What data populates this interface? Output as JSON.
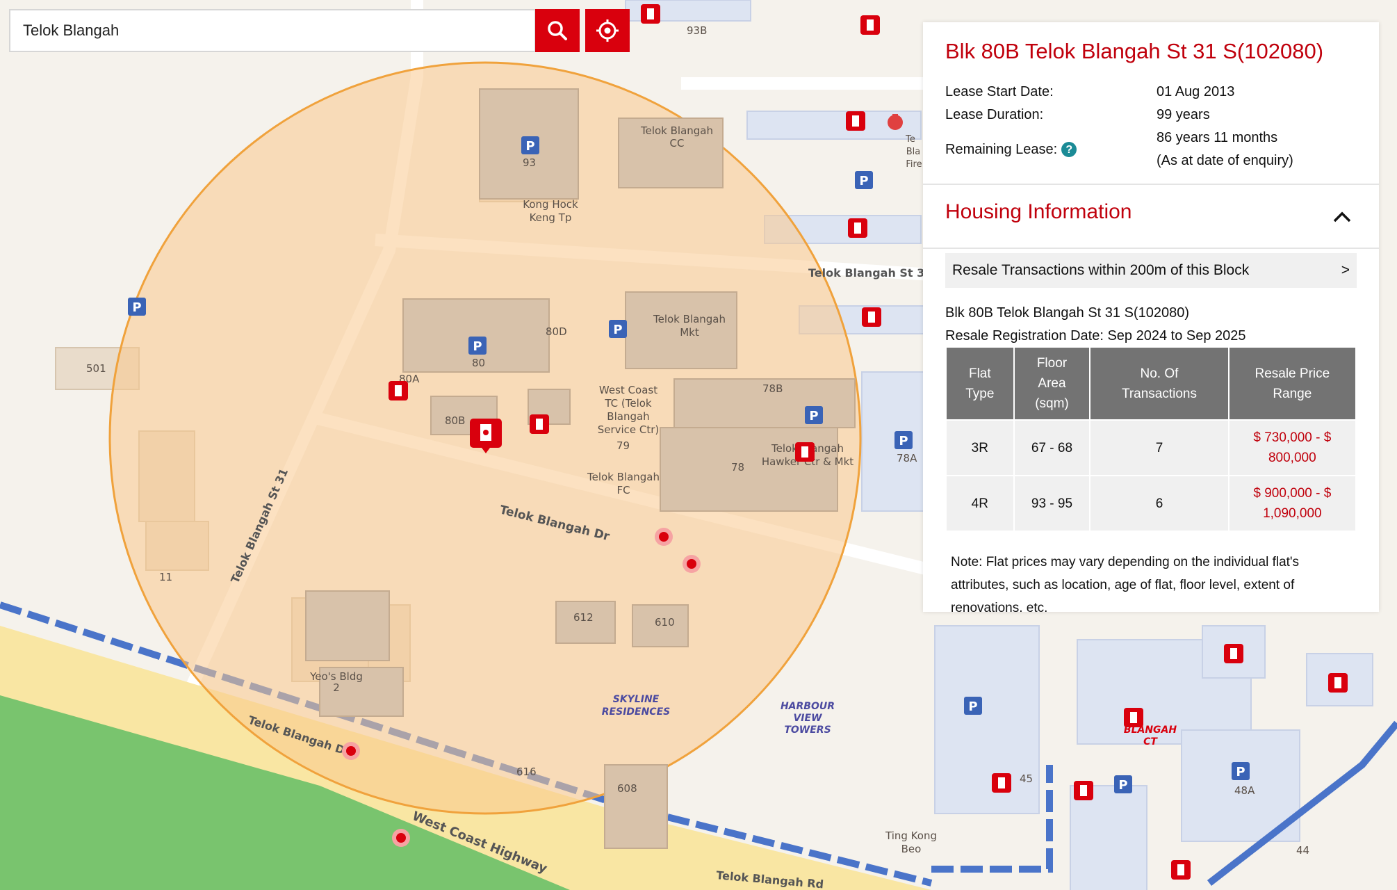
{
  "search": {
    "value": "Telok Blangah",
    "placeholder": ""
  },
  "buttons": {
    "search_icon": "search-icon",
    "locate_icon": "crosshair-icon"
  },
  "colors": {
    "brand_red": "#d9000d",
    "title_red": "#c0000c",
    "table_header": "#737373",
    "radius_fill": "#f9c98e",
    "radius_stroke": "#f0a23c"
  },
  "map_labels": {
    "blocks": [
      "93B",
      "93",
      "80D",
      "80",
      "80A",
      "80B",
      "79",
      "78B",
      "78",
      "78A",
      "501",
      "11",
      "612",
      "610",
      "616",
      "608",
      "45",
      "48A",
      "44"
    ],
    "places": [
      "Telok Blangah CC",
      "Kong Hock Keng Tp",
      "Telok Blangah Mkt",
      "West Coast TC (Telok Blangah Service Ctr)",
      "Telok Blangah FC",
      "Telok Blangah Hawker Ctr & Mkt",
      "Yeo's Bldg 2",
      "SKYLINE RESIDENCES",
      "HARBOUR VIEW TOWERS",
      "BLANGAH CT",
      "Ting Kong Beo"
    ],
    "places_split": {
      "tbcc_1": "Telok Blangah",
      "tbcc_2": "CC",
      "khkt_1": "Kong Hock",
      "khkt_2": "Keng Tp",
      "tbmkt_1": "Telok Blangah",
      "tbmkt_2": "Mkt",
      "wctc_1": "West Coast",
      "wctc_2": "TC (Telok",
      "wctc_3": "Blangah",
      "wctc_4": "Service Ctr)",
      "tbfc_1": "Telok Blangah",
      "tbfc_2": "FC",
      "tbhc_1": "Telok Blangah",
      "tbhc_2": "Hawker Ctr & Mkt",
      "yeo_1": "Yeo's Bldg",
      "yeo_2": "2",
      "sky_1": "SKYLINE",
      "sky_2": "RESIDENCES",
      "hvt_1": "HARBOUR",
      "hvt_2": "VIEW",
      "hvt_3": "TOWERS",
      "bct_1": "BLANGAH",
      "bct_2": "CT",
      "tkb_1": "Ting Kong",
      "tkb_2": "Beo",
      "fire_1": "Te",
      "fire_2": "Bla",
      "fire_3": "Fire"
    },
    "roads": {
      "st31_vertical": "Telok Blangah St 31",
      "st3_top": "Telok Blangah St 3",
      "dr": "Telok Blangah Dr",
      "lower": "Telok Blangah D",
      "wch": "West Coast Highway",
      "rd": "Telok Blangah Rd"
    }
  },
  "panel": {
    "title": "Blk 80B Telok Blangah St 31 S(102080)",
    "lease": [
      {
        "label": "Lease Start Date:",
        "value": "01 Aug 2013"
      },
      {
        "label": "Lease Duration:",
        "value": "99 years"
      },
      {
        "label": "Remaining Lease:",
        "value": "86 years 11 months",
        "note": "(As at date of enquiry)",
        "help_icon": "question-icon"
      }
    ],
    "housing_title": "Housing Information",
    "resale_link": {
      "label": "Resale Transactions within 200m of this Block",
      "arrow": ">"
    },
    "block_line": "Blk 80B Telok Blangah St 31 S(102080)",
    "registration_line": "Resale Registration Date: Sep 2024 to Sep 2025",
    "table": {
      "headers": [
        {
          "l1": "Flat",
          "l2": "Type"
        },
        {
          "l1": "Floor",
          "l2": "Area",
          "l3": "(sqm)"
        },
        {
          "l1": "No. Of",
          "l2": "Transactions"
        },
        {
          "l1": "Resale Price",
          "l2": "Range"
        }
      ],
      "rows": [
        {
          "type": "3R",
          "area": "67 - 68",
          "count": "7",
          "price_1": "$ 730,000 - $",
          "price_2": "800,000"
        },
        {
          "type": "4R",
          "area": "93 - 95",
          "count": "6",
          "price_1": "$ 900,000 - $",
          "price_2": "1,090,000"
        }
      ]
    },
    "note_1": "Note: Flat prices may vary depending on the individual flat's",
    "note_2": "attributes, such as location, age of flat, floor level, extent of",
    "note_3": "renovations, etc."
  }
}
